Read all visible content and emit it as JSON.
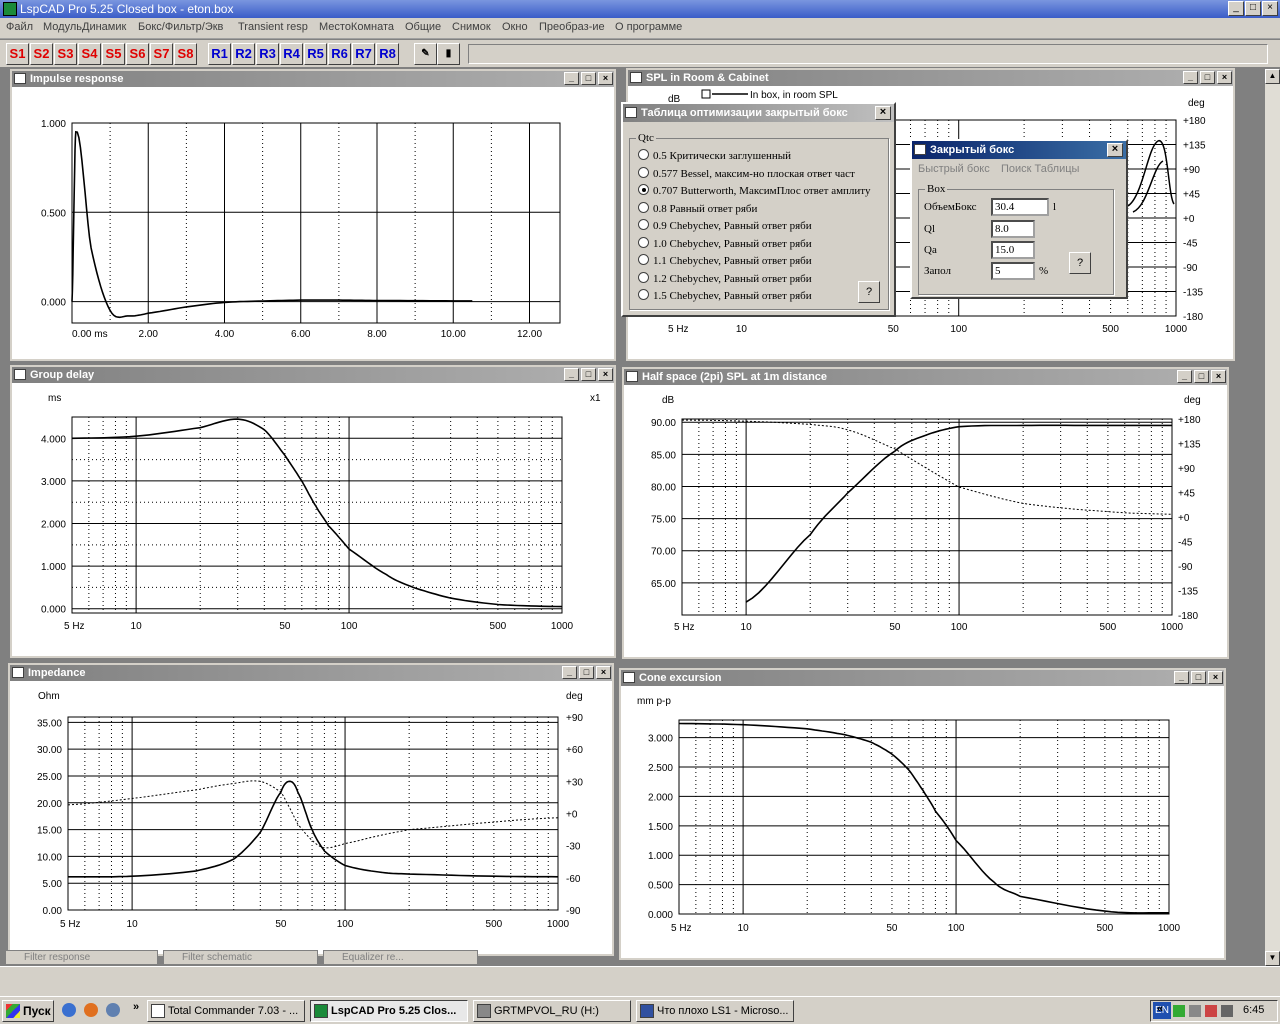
{
  "window": {
    "title": "LspCAD Pro 5.25 Closed box - eton.box"
  },
  "menu": [
    "Файл",
    "МодульДинамик",
    "Бокс/Фильтр/Экв",
    "Transient resp",
    "МестоКомната",
    "Общие",
    "Снимок",
    "Окно",
    "Преобраз-ие",
    "О программе"
  ],
  "toolbar": {
    "s_buttons": [
      "S1",
      "S2",
      "S3",
      "S4",
      "S5",
      "S6",
      "S7",
      "S8"
    ],
    "r_buttons": [
      "R1",
      "R2",
      "R3",
      "R4",
      "R5",
      "R6",
      "R7",
      "R8"
    ]
  },
  "windows": {
    "impulse": {
      "title": "Impulse response"
    },
    "group_delay": {
      "title": "Group delay",
      "ylabel": "ms",
      "right_label": "x1"
    },
    "impedance": {
      "title": "Impedance",
      "ylabel": "Ohm",
      "right_label": "deg"
    },
    "spl_room": {
      "title": "SPL in Room & Cabinet",
      "ylabel": "dB",
      "right_label": "deg",
      "legend": "In box, in room SPL"
    },
    "half_space": {
      "title": "Half space (2pi) SPL at 1m distance",
      "ylabel": "dB",
      "right_label": "deg"
    },
    "cone": {
      "title": "Cone excursion",
      "ylabel": "mm p-p"
    }
  },
  "axes": {
    "time_ticks": [
      "0.00 ms",
      "2.00",
      "4.00",
      "6.00",
      "8.00",
      "10.00",
      "12.00"
    ],
    "impulse_y": [
      "1.000",
      "0.500",
      "0.000"
    ],
    "freq_ticks": [
      "5 Hz",
      "10",
      "50",
      "100",
      "500",
      "1000"
    ],
    "gd_y": [
      "4.000",
      "3.000",
      "2.000",
      "1.000",
      "0.000"
    ],
    "imp_y": [
      "35.00",
      "30.00",
      "25.00",
      "20.00",
      "15.00",
      "10.00",
      "5.00",
      "0.00"
    ],
    "imp_deg": [
      "+90",
      "+60",
      "+30",
      "+0",
      "-30",
      "-60",
      "-90"
    ],
    "hs_y": [
      "90.00",
      "85.00",
      "80.00",
      "75.00",
      "70.00",
      "65.00"
    ],
    "deg_180": [
      "+180",
      "+135",
      "+90",
      "+45",
      "+0",
      "-45",
      "-90",
      "-135",
      "-180"
    ],
    "cone_y": [
      "3.000",
      "2.500",
      "2.000",
      "1.500",
      "1.000",
      "0.500",
      "0.000"
    ]
  },
  "chart_data": [
    {
      "type": "line",
      "title": "Impulse response",
      "x": [
        0,
        0.1,
        0.5,
        1,
        1.5,
        2,
        3,
        4,
        5,
        6,
        7,
        8,
        10,
        10.5
      ],
      "series": [
        {
          "values": [
            0,
            0.95,
            0.3,
            -0.05,
            -0.08,
            -0.065,
            -0.03,
            -0.005,
            0.003,
            0.008,
            0.008,
            0.006,
            0.004,
            0.004
          ]
        }
      ],
      "xlim": [
        0,
        13
      ],
      "ylim": [
        -0.1,
        1.0
      ]
    },
    {
      "type": "line",
      "title": "Group delay",
      "x": [
        5,
        10,
        20,
        30,
        40,
        50,
        60,
        70,
        80,
        100,
        150,
        200,
        300,
        500,
        1000
      ],
      "series": [
        {
          "values": [
            4.0,
            4.05,
            4.25,
            4.45,
            4.2,
            3.6,
            3.0,
            2.4,
            1.95,
            1.4,
            0.8,
            0.5,
            0.25,
            0.1,
            0.05
          ]
        }
      ],
      "xlim": [
        5,
        1000
      ],
      "ylim": [
        0,
        4.5
      ],
      "xscale": "log"
    },
    {
      "type": "line",
      "title": "Impedance",
      "x": [
        5,
        10,
        20,
        30,
        40,
        50,
        55,
        60,
        70,
        80,
        100,
        150,
        200,
        500,
        1000
      ],
      "series": [
        {
          "name": "magnitude",
          "values": [
            6.2,
            6.3,
            7.3,
            9.5,
            14.5,
            22,
            24,
            22,
            15,
            11,
            8.3,
            7,
            6.7,
            6.3,
            6.2
          ]
        },
        {
          "name": "phase",
          "values": [
            8,
            14,
            22,
            28,
            30,
            20,
            5,
            -10,
            -25,
            -32,
            -28,
            -20,
            -15,
            -8,
            -4
          ]
        }
      ],
      "xlim": [
        5,
        1000
      ],
      "ylim": [
        0,
        35
      ],
      "xscale": "log"
    },
    {
      "type": "line",
      "title": "Half space (2pi) SPL at 1m distance",
      "x": [
        10,
        20,
        30,
        50,
        70,
        100,
        200,
        500,
        1000
      ],
      "series": [
        {
          "name": "SPL",
          "values": [
            62,
            72.5,
            79,
            85.5,
            88,
            89.3,
            89.5,
            89.5,
            89.5
          ]
        },
        {
          "name": "phase",
          "values": [
            176,
            170,
            160,
            125,
            90,
            55,
            25,
            10,
            5
          ]
        }
      ],
      "xlim": [
        5,
        1000
      ],
      "ylim": [
        60,
        90
      ],
      "xscale": "log"
    },
    {
      "type": "line",
      "title": "Cone excursion",
      "x": [
        5,
        10,
        20,
        30,
        40,
        50,
        60,
        70,
        80,
        100,
        150,
        200,
        500,
        1000
      ],
      "series": [
        {
          "values": [
            3.24,
            3.22,
            3.15,
            3.05,
            2.92,
            2.72,
            2.45,
            2.1,
            1.75,
            1.25,
            0.55,
            0.3,
            0.05,
            0.02
          ]
        }
      ],
      "xlim": [
        5,
        1000
      ],
      "ylim": [
        0,
        3.3
      ],
      "xscale": "log"
    }
  ],
  "dialog_table": {
    "title": "Таблица оптимизации закрытый бокс",
    "group": "Qtc",
    "options": [
      "0.5 Критически заглушенный",
      "0.577 Bessel, максим-но плоская ответ част",
      "0.707 Butterworth, МаксимПлос ответ амплиту",
      "0.8 Равный ответ ряби",
      "0.9 Chebychev, Равный ответ ряби",
      "1.0 Chebychev, Равный ответ ряби",
      "1.1 Chebychev, Равный ответ ряби",
      "1.2 Chebychev, Равный ответ ряби",
      "1.5 Chebychev, Равный ответ ряби"
    ],
    "selected": 2,
    "help": "?"
  },
  "dialog_box": {
    "title": "Закрытый бокс",
    "tabs": [
      "Быстрый бокс",
      "Поиск Таблицы"
    ],
    "group": "Box",
    "fields": [
      {
        "label": "ОбъемБокс",
        "value": "30.4",
        "unit": "l"
      },
      {
        "label": "Ql",
        "value": "8.0",
        "unit": ""
      },
      {
        "label": "Qa",
        "value": "15.0",
        "unit": ""
      },
      {
        "label": "Запол",
        "value": "5",
        "unit": "%"
      }
    ],
    "help": "?"
  },
  "minimized": [
    "Filter response",
    "Filter schematic",
    "Equalizer re..."
  ],
  "taskbar": {
    "start": "Пуск",
    "tasks": [
      "Total Commander 7.03 - ...",
      "LspCAD Pro 5.25 Clos...",
      "GRTMPVOL_RU (H:)",
      "Что плохо LS1 - Microso..."
    ],
    "active": 1,
    "lang": "EN",
    "clock": "6:45"
  }
}
